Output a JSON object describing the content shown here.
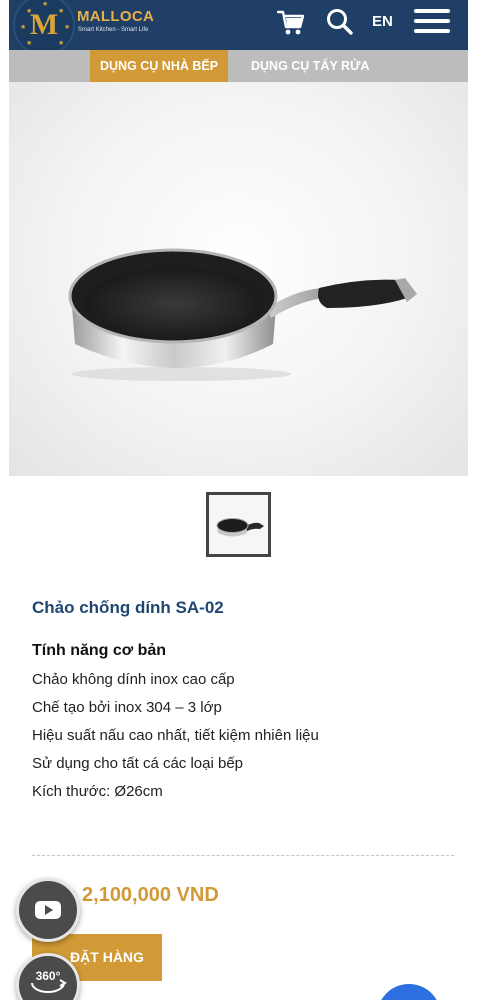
{
  "header": {
    "logo_letter": "M",
    "brand": "MALLOCA",
    "tagline": "Smart Kitchen - Smart Life",
    "language": "EN",
    "icons": [
      "cart-icon",
      "search-icon",
      "menu-icon"
    ]
  },
  "categories": [
    {
      "label": "DỤNG CỤ NHÀ BẾP",
      "active": true
    },
    {
      "label": "DỤNG CỤ TẨY RỬA",
      "active": false
    }
  ],
  "product": {
    "title": "Chảo chống dính SA-02",
    "features_heading": "Tính năng cơ bản",
    "features": [
      "Chảo không dính inox cao cấp",
      "Chế tạo bởi inox 304 – 3 lớp",
      "Hiệu suất nấu cao nhất, tiết kiệm nhiên liệu",
      "Sử dụng cho tất cá các loại bếp",
      "Kích thước: Ø26cm"
    ],
    "price": "Giá : 2,100,000 VND",
    "order_label": "ĐẶT HÀNG"
  },
  "floating": {
    "video_icon": "youtube-icon",
    "view360_label": "360°"
  },
  "colors": {
    "header_bg": "#1f3f66",
    "accent": "#d19a36",
    "title": "#1f4770"
  }
}
